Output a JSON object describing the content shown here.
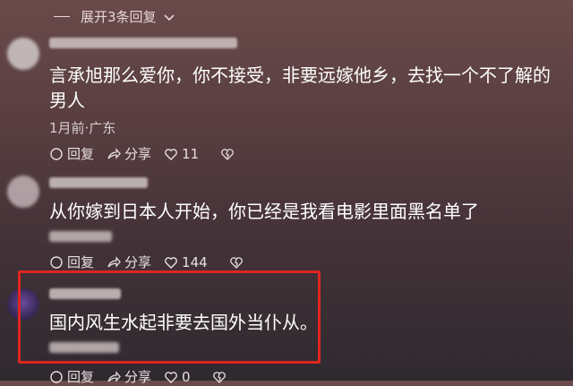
{
  "header": {
    "expand_label": "展开3条回复"
  },
  "comments": [
    {
      "text": "言承旭那么爱你，你不接受，非要远嫁他乡，去找一个不了解的男人",
      "meta": "1月前·广东",
      "reply_label": "回复",
      "share_label": "分享",
      "like_count": "11"
    },
    {
      "text": "从你嫁到日本人开始，你已经是我看电影里面黑名单了",
      "meta": "",
      "reply_label": "回复",
      "share_label": "分享",
      "like_count": "144"
    },
    {
      "text": "国内风生水起非要去国外当仆从。",
      "meta": "",
      "reply_label": "回复",
      "share_label": "分享",
      "like_count": "0"
    }
  ],
  "colors": {
    "highlight_box": "#e0251f"
  }
}
